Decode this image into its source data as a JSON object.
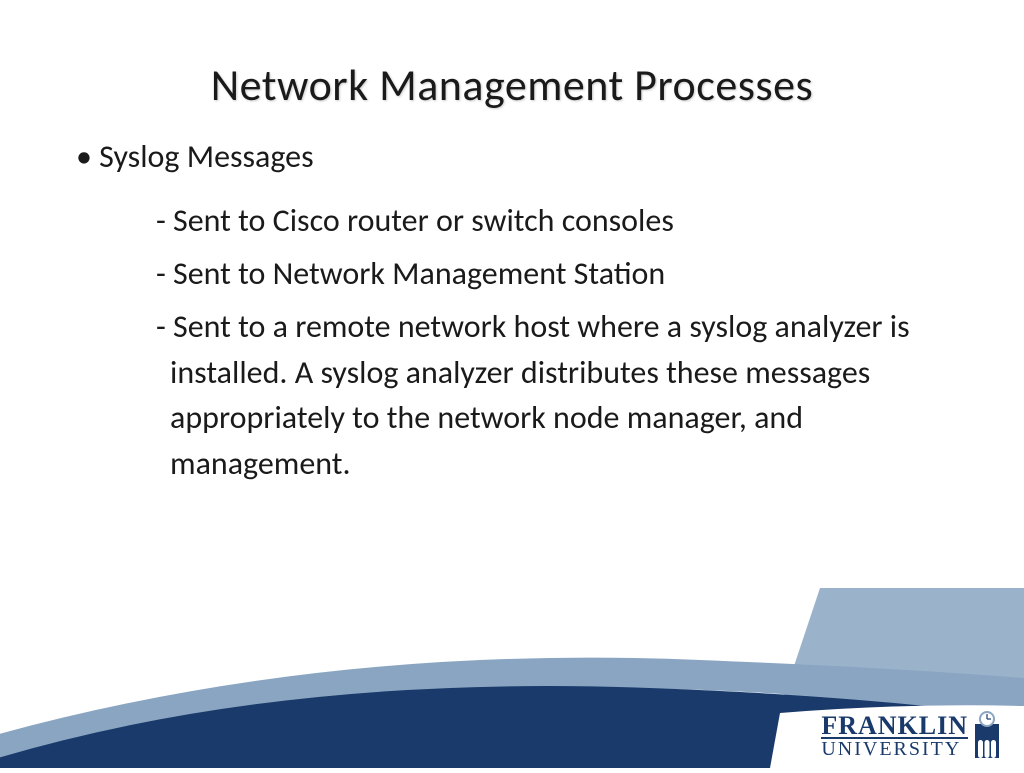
{
  "slide": {
    "title": "Network Management Processes",
    "bullet_main": "Syslog Messages",
    "sub_points": [
      "- Sent to Cisco router or switch consoles",
      "- Sent to Network Management Station",
      "- Sent to a remote network host where a syslog analyzer is installed.  A syslog analyzer distributes these messages appropriately to the network node manager, and management."
    ]
  },
  "logo": {
    "line1": "FRANKLIN",
    "line2": "UNIVERSITY"
  },
  "colors": {
    "dark_blue": "#1a3a6b",
    "light_blue": "#8aa5c2"
  }
}
